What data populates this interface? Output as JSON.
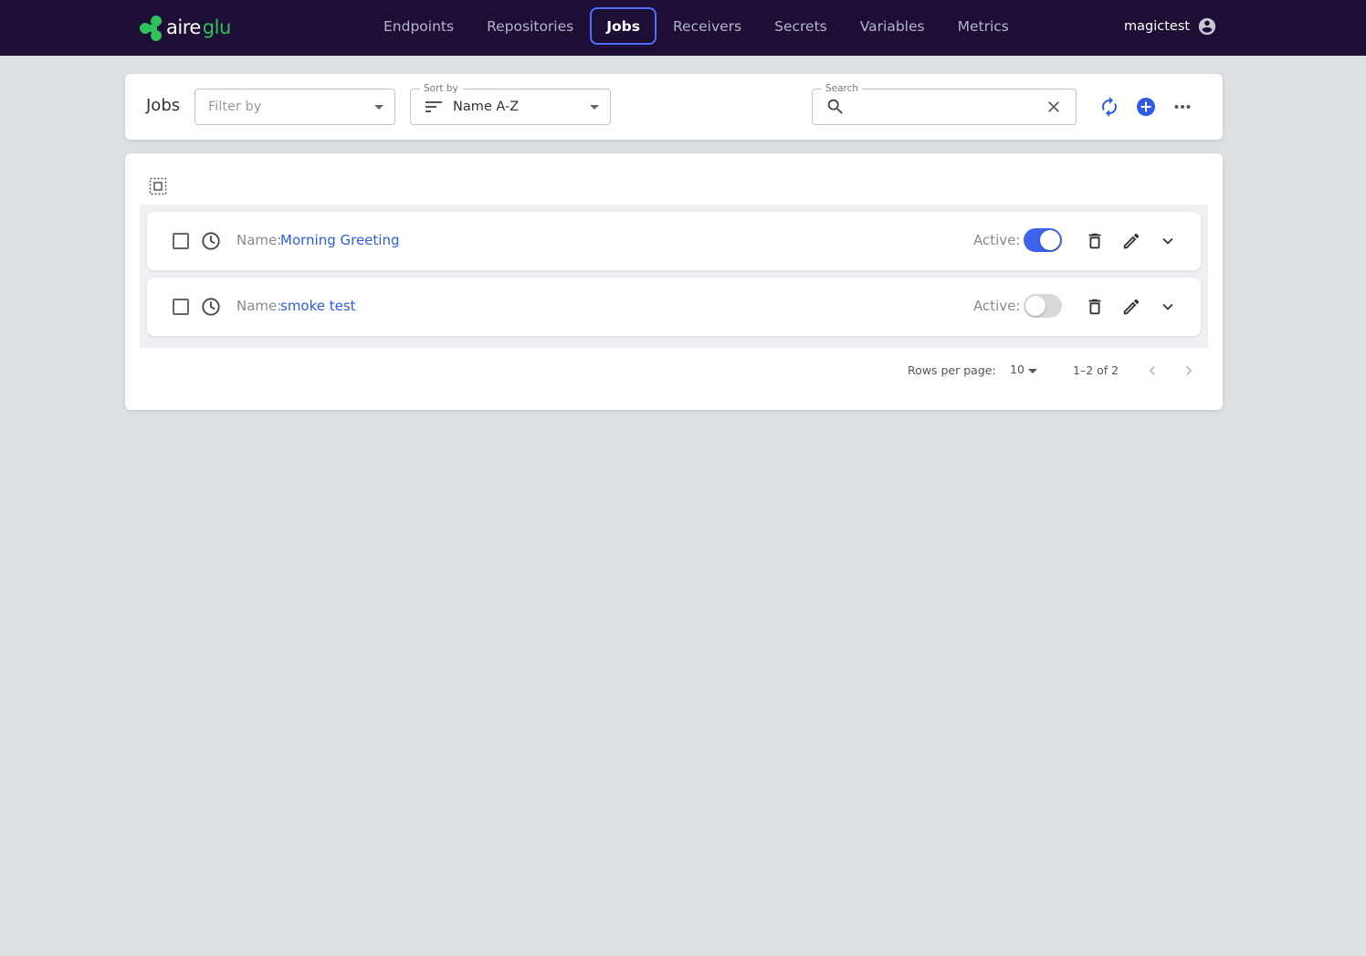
{
  "brand": {
    "part1": "aire",
    "part2": "glu",
    "accent_color": "#2fc15a"
  },
  "nav": {
    "items": [
      {
        "label": "Endpoints",
        "active": false
      },
      {
        "label": "Repositories",
        "active": false
      },
      {
        "label": "Jobs",
        "active": true
      },
      {
        "label": "Receivers",
        "active": false
      },
      {
        "label": "Secrets",
        "active": false
      },
      {
        "label": "Variables",
        "active": false
      },
      {
        "label": "Metrics",
        "active": false
      }
    ],
    "background": "#1c0e35",
    "active_border": "#4d6fff"
  },
  "user": {
    "name": "magictest",
    "icon": "account-circle-icon"
  },
  "toolbar": {
    "title": "Jobs",
    "filter": {
      "placeholder": "Filter by"
    },
    "sort": {
      "label": "Sort by",
      "value": "Name A-Z"
    },
    "search": {
      "label": "Search",
      "value": ""
    },
    "actions": [
      "refresh-icon",
      "add-circle-icon",
      "more-horizontal-icon"
    ]
  },
  "jobs": {
    "rows": [
      {
        "name_label": "Name:",
        "name": "Morning Greeting",
        "active_label": "Active:",
        "active": true
      },
      {
        "name_label": "Name:",
        "name": "smoke test",
        "active_label": "Active:",
        "active": false
      }
    ],
    "link_color": "#2f5be8",
    "toggle_on_color": "#3d63ea"
  },
  "pagination": {
    "rows_per_page_label": "Rows per page:",
    "rows_per_page": "10",
    "range": "1–2 of 2"
  }
}
